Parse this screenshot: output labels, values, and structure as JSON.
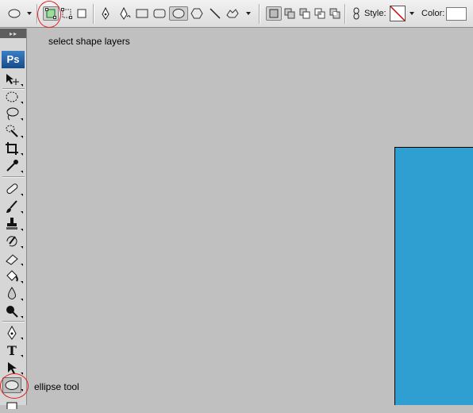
{
  "options_bar": {
    "style_label": "Style:",
    "color_label": "Color:",
    "colors": {
      "swatch_fill": "#ffffff",
      "no_style_slash": "#d40000"
    }
  },
  "toolbox": {
    "logo": "Ps"
  },
  "annotations": {
    "shape_layers_note": "select shape layers",
    "ellipse_tool_note": "ellipse tool",
    "circle_color": "#e02020"
  },
  "canvas": {
    "document_fill": "#2e9fd0",
    "workspace_fill": "#c0c0c0"
  }
}
